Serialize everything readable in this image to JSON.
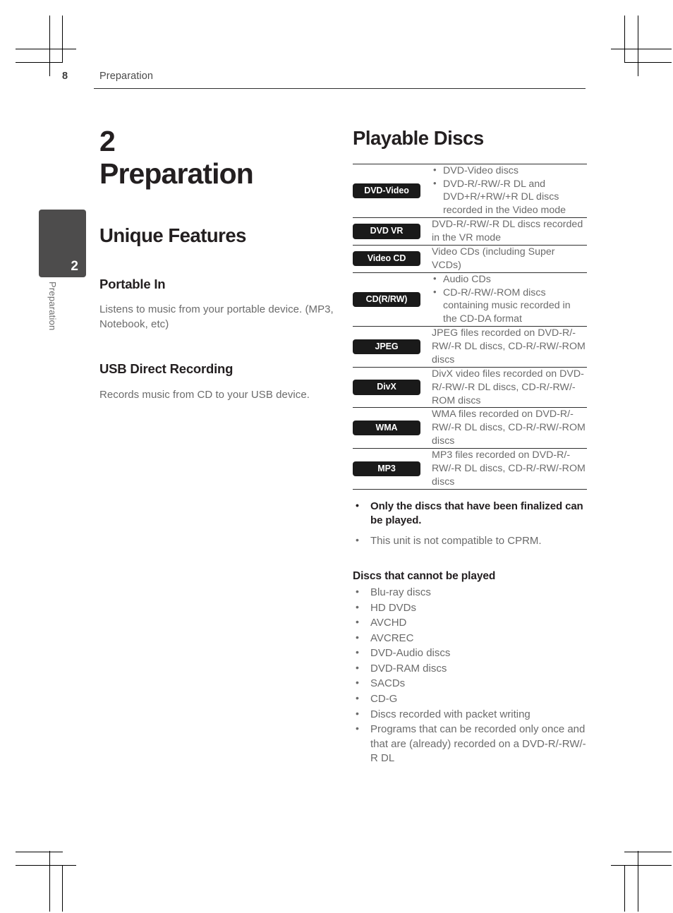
{
  "header": {
    "page_number": "8",
    "section": "Preparation"
  },
  "side_tab": {
    "number": "2",
    "label": "Preparation"
  },
  "left_column": {
    "chapter_number": "2",
    "chapter_title": "Preparation",
    "section_title": "Unique Features",
    "features": [
      {
        "title": "Portable In",
        "body": "Listens to music from your portable device. (MP3, Notebook, etc)"
      },
      {
        "title": "USB Direct Recording",
        "body": "Records music from CD to your USB device."
      }
    ]
  },
  "right_column": {
    "section_title": "Playable Discs",
    "disc_table": [
      {
        "badge": "DVD-Video",
        "bullets": [
          "DVD-Video discs",
          "DVD-R/-RW/-R DL and DVD+R/+RW/+R DL discs recorded in the Video mode"
        ]
      },
      {
        "badge": "DVD VR",
        "text": "DVD-R/-RW/-R DL discs recorded in the VR mode"
      },
      {
        "badge": "Video CD",
        "text": "Video CDs (including Super VCDs)"
      },
      {
        "badge": "CD(R/RW)",
        "bullets": [
          "Audio CDs",
          "CD-R/-RW/-ROM discs containing music recorded in the CD-DA format"
        ]
      },
      {
        "badge": "JPEG",
        "text": "JPEG files recorded on DVD-R/-RW/-R DL discs, CD-R/-RW/-ROM discs"
      },
      {
        "badge": "DivX",
        "text": "DivX video files recorded on DVD-R/-RW/-R DL discs, CD-R/-RW/-ROM discs"
      },
      {
        "badge": "WMA",
        "text": "WMA files recorded on DVD-R/-RW/-R DL discs, CD-R/-RW/-ROM discs"
      },
      {
        "badge": "MP3",
        "text": "MP3 files recorded on DVD-R/-RW/-R DL discs, CD-R/-RW/-ROM discs"
      }
    ],
    "notes": [
      "Only the discs that have been finalized can be played.",
      "This unit is not compatible to CPRM."
    ],
    "cannot_play_title": "Discs that cannot be played",
    "cannot_play_items": [
      "Blu-ray discs",
      "HD DVDs",
      "AVCHD",
      "AVCREC",
      "DVD-Audio discs",
      "DVD-RAM discs",
      "SACDs",
      "CD-G",
      "Discs recorded with packet writing",
      "Programs that can be recorded only once and that are (already) recorded on a DVD-R/-RW/-R DL"
    ]
  },
  "colors": {
    "badge_background": "#1a1a1a",
    "heading": "#231f20",
    "body_text": "#6b6b6b",
    "rule": "#2f2f2f",
    "side_tab": "#4d4c4c"
  }
}
